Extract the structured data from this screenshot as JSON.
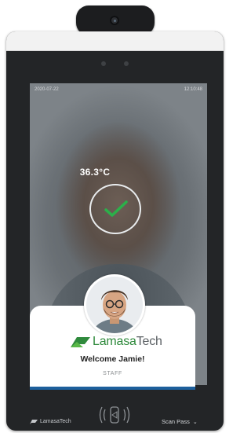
{
  "header": {
    "camera_icon": "camera-icon"
  },
  "screen": {
    "date": "2020-07-22",
    "time": "12:10:48",
    "status_icon": "checkmark-icon",
    "temperature": "36.3°C"
  },
  "card": {
    "logo": "LamasaTech",
    "welcome": "Welcome Jamie!",
    "role": "STAFF"
  },
  "footer": {
    "brand": "LamasaTech",
    "nfc_icon": "nfc-icon",
    "scan_label": "Scan Pass",
    "chevron": "⌄"
  },
  "colors": {
    "brand_green": "#2f8a3c",
    "brand_gray": "#5a5f63",
    "check_green": "#2bb04a",
    "card_border_blue": "#1d5f9c"
  }
}
